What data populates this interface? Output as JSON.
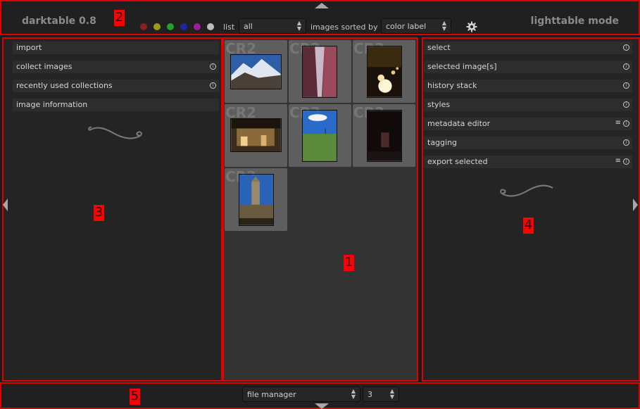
{
  "topbar": {
    "app_title": "darktable 0.8",
    "mode_title": "lighttable mode",
    "color_labels": [
      {
        "name": "red",
        "color": "#8b1e1e"
      },
      {
        "name": "yellow",
        "color": "#9a9a1c"
      },
      {
        "name": "green",
        "color": "#22a02a"
      },
      {
        "name": "blue",
        "color": "#1c28a0"
      },
      {
        "name": "purple",
        "color": "#9a1e9a"
      },
      {
        "name": "grey",
        "color": "#bdbdbd"
      }
    ],
    "list_label": "list",
    "list_value": "all",
    "sorted_label": "images sorted by",
    "sort_value": "color label",
    "settings_icon": "gear-icon"
  },
  "left_panel": {
    "modules": [
      {
        "label": "import",
        "has_info": false
      },
      {
        "label": "collect images",
        "has_info": true
      },
      {
        "label": "recently used collections",
        "has_info": true
      },
      {
        "label": "image information",
        "has_info": false
      }
    ]
  },
  "right_panel": {
    "modules": [
      {
        "label": "select",
        "has_menu": false
      },
      {
        "label": "selected image[s]",
        "has_menu": false
      },
      {
        "label": "history stack",
        "has_menu": false
      },
      {
        "label": "styles",
        "has_menu": false
      },
      {
        "label": "metadata editor",
        "has_menu": true
      },
      {
        "label": "tagging",
        "has_menu": false
      },
      {
        "label": "export selected",
        "has_menu": true
      }
    ]
  },
  "center": {
    "thumbnails": [
      {
        "label": "CR2",
        "subject": "snowy-mountain-photo"
      },
      {
        "label": "CR2",
        "subject": "red-alley-photo"
      },
      {
        "label": "CR2",
        "subject": "glowing-spheres-photo"
      },
      {
        "label": "CR2",
        "subject": "night-building-photo"
      },
      {
        "label": "CR2",
        "subject": "green-hill-photo"
      },
      {
        "label": "CR2",
        "subject": "dark-doorway-photo"
      },
      {
        "label": "CR2",
        "subject": "church-tower-photo"
      }
    ]
  },
  "bottombar": {
    "view_value": "file manager",
    "zoom_value": "3"
  },
  "annotations": {
    "center": "1",
    "topbar": "2",
    "left": "3",
    "right": "4",
    "bottom": "5"
  }
}
